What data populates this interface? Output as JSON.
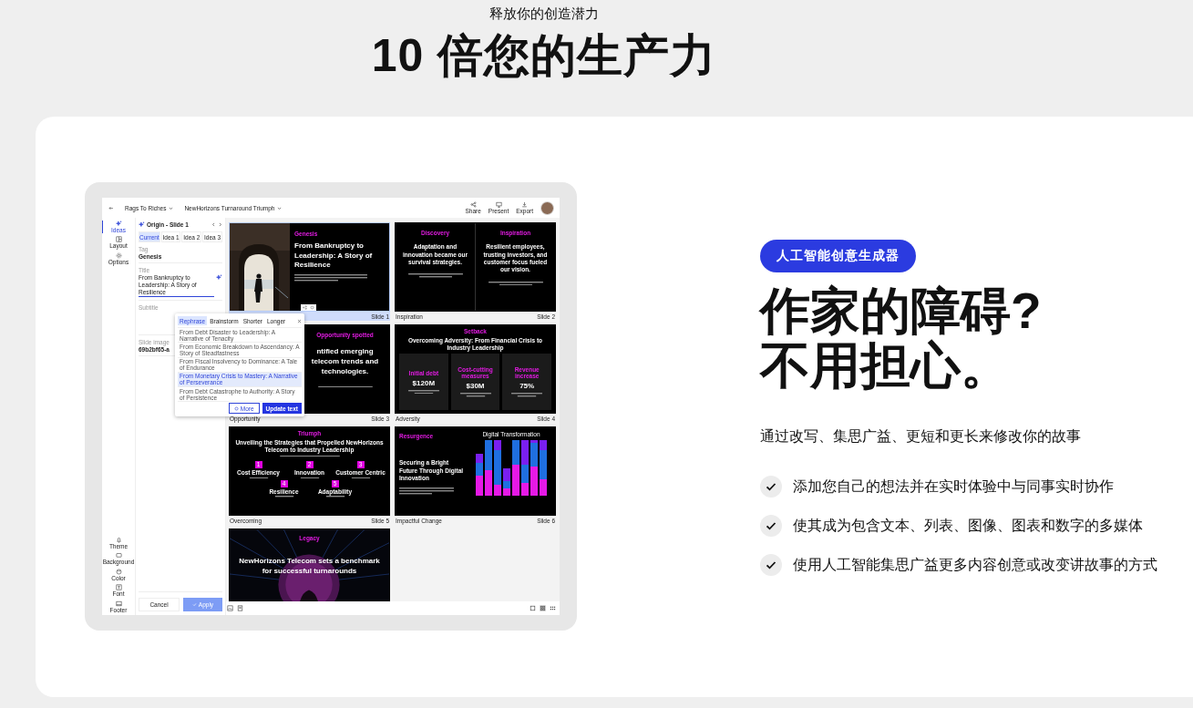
{
  "hero": {
    "eyebrow": "释放你的创造潜力",
    "title": "10 倍您的生产力"
  },
  "app": {
    "breadcrumbs": [
      {
        "label": "Rags To Riches"
      },
      {
        "label": "NewHorizons Turnaround Triumph"
      }
    ],
    "actions": [
      {
        "label": "Share"
      },
      {
        "label": "Present"
      },
      {
        "label": "Export"
      }
    ],
    "rail_top": [
      {
        "label": "Ideas",
        "selected": true
      },
      {
        "label": "Layout",
        "selected": false
      },
      {
        "label": "Options",
        "selected": false
      }
    ],
    "rail_bottom": [
      {
        "label": "Theme"
      },
      {
        "label": "Background"
      },
      {
        "label": "Color"
      },
      {
        "label": "Font"
      },
      {
        "label": "Footer"
      }
    ],
    "panel": {
      "title": "Origin - Slide 1",
      "tabs": [
        {
          "label": "Current",
          "selected": true
        },
        {
          "label": "Idea 1",
          "selected": false
        },
        {
          "label": "Idea 2",
          "selected": false
        },
        {
          "label": "Idea 3",
          "selected": false
        }
      ],
      "tag": {
        "label": "Tag",
        "value": "Genesis"
      },
      "title_field": {
        "label": "Title",
        "value": "From Bankruptcy to Leadership: A Story of Resilience"
      },
      "subtitle": {
        "label": "Subtitle"
      },
      "image": {
        "label": "Slide image",
        "value": "69b2bf65-a"
      },
      "cancel": "Cancel",
      "apply": "Apply"
    },
    "popup": {
      "tabs": [
        {
          "label": "Rephrase",
          "selected": true
        },
        {
          "label": "Brainstorm",
          "selected": false
        },
        {
          "label": "Shorter",
          "selected": false
        },
        {
          "label": "Longer",
          "selected": false
        }
      ],
      "options": [
        {
          "text": "From Debt Disaster to Leadership: A Narrative of Tenacity",
          "selected": false
        },
        {
          "text": "From Economic Breakdown to Ascendancy: A Story of Steadfastness",
          "selected": false
        },
        {
          "text": "From Fiscal Insolvency to Dominance: A Tale of Endurance",
          "selected": false
        },
        {
          "text": "From Monetary Crisis to Mastery: A Narrative of Perseverance",
          "selected": true
        },
        {
          "text": "From Debt Catastrophe to Authority: A Story of Persistence",
          "selected": false
        }
      ],
      "more": "More",
      "update": "Update text"
    },
    "slides": [
      {
        "selected": true,
        "number": "Slide 1",
        "tag": "Genesis",
        "title": "From Bankruptcy to Leadership: A Story of Resilience"
      },
      {
        "kind": "columns",
        "selected": false,
        "name": "Inspiration",
        "number": "Slide 2",
        "columns": [
          {
            "tag": "Discovery",
            "title": "Adaptation and innovation became our survival strategies."
          },
          {
            "tag": "Inspiration",
            "title": "Resilient employees, trusting investors, and customer focus fueled our vision."
          }
        ]
      },
      {
        "kind": "statement",
        "selected": false,
        "name": "Opportunity",
        "number": "Slide 3",
        "tag": "Opportunity spotted",
        "title": "ntified emerging telecom trends and technologies."
      },
      {
        "kind": "stats",
        "selected": false,
        "name": "Adversity",
        "number": "Slide 4",
        "tag": "Setback",
        "title": "Overcoming Adversity: From Financial Crisis to Industry Leadership",
        "stats": [
          {
            "label": "Initial debt",
            "value": "$120M"
          },
          {
            "label": "Cost-cutting measures",
            "value": "$30M"
          },
          {
            "label": "Revenue increase",
            "value": "75%"
          }
        ]
      },
      {
        "kind": "steps",
        "selected": false,
        "name": "Overcoming",
        "number": "Slide 5",
        "tag": "Triumph",
        "title": "Unveiling the Strategies that Propelled NewHorizons Telecom to Industry Leadership",
        "steps": [
          {
            "n": "1",
            "title": "Cost Efficiency"
          },
          {
            "n": "2",
            "title": "Innovation"
          },
          {
            "n": "3",
            "title": "Customer Centric"
          },
          {
            "n": "4",
            "title": "Resilience"
          },
          {
            "n": "5",
            "title": "Adaptability"
          }
        ]
      },
      {
        "kind": "chart",
        "selected": false,
        "name": "Impactful Change",
        "number": "Slide 6",
        "tag": "Resurgence",
        "title": "Securing a Bright Future Through Digital Innovation",
        "chart_title": "Digital Transformation"
      },
      {
        "kind": "hero",
        "selected": false,
        "tag": "Legacy",
        "title": "NewHorizons Telecom sets a benchmark for successful turnarounds"
      }
    ]
  },
  "feature": {
    "badge": "人工智能创意生成器",
    "heading": [
      "作家的障碍?",
      "不用担心。"
    ],
    "intro": "通过改写、集思广益、更短和更长来修改你的故事",
    "points": [
      {
        "text": "添加您自己的想法并在实时体验中与同事实时协作"
      },
      {
        "text": "使其成为包含文本、列表、图像、图表和数字的多媒体"
      },
      {
        "text": "使用人工智能集思广益更多内容创意或改变讲故事的方式"
      }
    ]
  }
}
